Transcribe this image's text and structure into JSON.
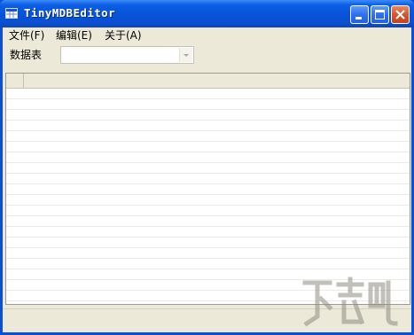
{
  "window": {
    "title": "TinyMDBEditor",
    "icon": "table-grid-icon",
    "controls": [
      "minimize-icon",
      "maximize-icon",
      "close-icon"
    ]
  },
  "menu": {
    "items": [
      {
        "label": "文件(F)"
      },
      {
        "label": "编辑(E)"
      },
      {
        "label": "关于(A)"
      }
    ]
  },
  "toolbar": {
    "table_label": "数据表",
    "table_select_value": ""
  },
  "grid": {
    "columns": [],
    "rows": []
  },
  "colors": {
    "titlebar": "#0753d8",
    "client": "#ece9d8",
    "close_button": "#d4572e"
  }
}
